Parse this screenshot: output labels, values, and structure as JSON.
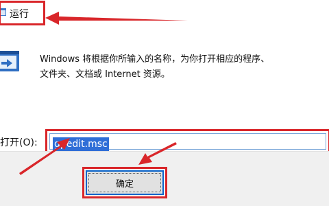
{
  "dialog": {
    "title": "运行",
    "description_line1": "Windows 将根据你所输入的名称，为你打开相应的程序、",
    "description_line2": "文件夹、文档或 Internet 资源。",
    "open_label": "打开(O):",
    "open_value": "gpedit.msc",
    "ok_label": "确定"
  },
  "colors": {
    "annotation_red": "#d9262a",
    "selection_blue": "#2f6ed7",
    "button_focus_border": "#0a64c9",
    "footer_bg": "#f0f0f0"
  },
  "icons": {
    "title_icon": "run-app-icon",
    "body_icon": "run-dialog-icon"
  }
}
